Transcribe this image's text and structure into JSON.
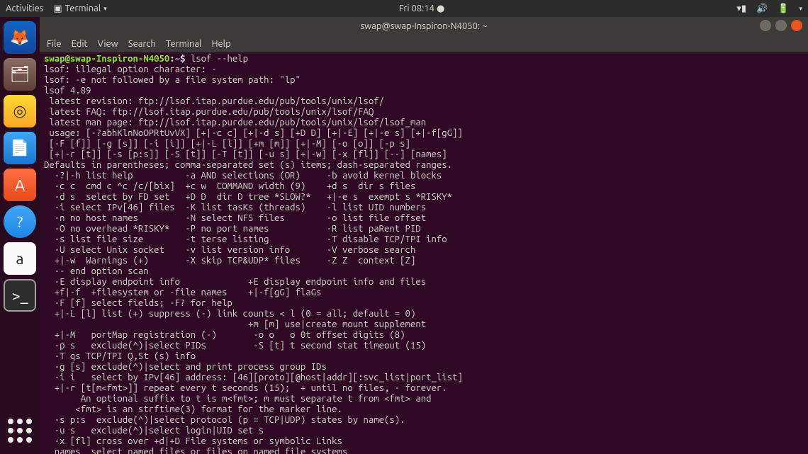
{
  "topbar": {
    "activities": "Activities",
    "app_menu": "Terminal",
    "clock": "Fri 08:14",
    "indicators": {
      "wifi": "wifi-icon",
      "volume": "volume-icon",
      "battery": "battery-icon",
      "power": "power-icon"
    }
  },
  "launcher": [
    {
      "name": "firefox",
      "glyph": "🦊"
    },
    {
      "name": "files",
      "glyph": "🗂"
    },
    {
      "name": "rhythmbox",
      "glyph": "◎"
    },
    {
      "name": "writer",
      "glyph": "📄"
    },
    {
      "name": "software",
      "glyph": "A"
    },
    {
      "name": "help",
      "glyph": "?"
    },
    {
      "name": "amazon",
      "glyph": "a"
    },
    {
      "name": "terminal",
      "glyph": ">_"
    }
  ],
  "window": {
    "title": "swap@swap-Inspiron-N4050: ~",
    "menus": [
      "File",
      "Edit",
      "View",
      "Search",
      "Terminal",
      "Help"
    ]
  },
  "prompt": {
    "user_host": "swap@swap-Inspiron-N4050",
    "sep": ":",
    "path": "~",
    "dollar": "$",
    "command": "lsof --help"
  },
  "terminal_output": [
    "lsof: illegal option character: -",
    "lsof: -e not followed by a file system path: \"lp\"",
    "lsof 4.89",
    " latest revision: ftp://lsof.itap.purdue.edu/pub/tools/unix/lsof/",
    " latest FAQ: ftp://lsof.itap.purdue.edu/pub/tools/unix/lsof/FAQ",
    " latest man page: ftp://lsof.itap.purdue.edu/pub/tools/unix/lsof/lsof_man",
    " usage: [-?abhKlnNoOPRtUvVX] [+|-c c] [+|-d s] [+D D] [+|-E] [+|-e s] [+|-f[gG]]",
    " [-F [f]] [-g [s]] [-i [i]] [+|-L [l]] [+m [m]] [+|-M] [-o [o]] [-p s]",
    " [+|-r [t]] [-s [p:s]] [-S [t]] [-T [t]] [-u s] [+|-w] [-x [fl]] [--] [names]",
    "Defaults in parentheses; comma-separated set (s) items; dash-separated ranges.",
    "  -?|-h list help          -a AND selections (OR)     -b avoid kernel blocks",
    "  -c c  cmd c ^c /c/[bix]  +c w  COMMAND width (9)    +d s  dir s files",
    "  -d s  select by FD set   +D D  dir D tree *SLOW?*   +|-e s  exempt s *RISKY*",
    "  -i select IPv[46] files  -K list tasKs (threads)    -l list UID numbers",
    "  -n no host names         -N select NFS files        -o list file offset",
    "  -O no overhead *RISKY*   -P no port names           -R list paRent PID",
    "  -s list file size        -t terse listing           -T disable TCP/TPI info",
    "  -U select Unix socket    -v list version info       -V verbose search",
    "  +|-w  Warnings (+)       -X skip TCP&UDP* files     -Z Z  context [Z]",
    "  -- end option scan     ",
    "  -E display endpoint info             +E display endpoint info and files",
    "  +f|-f  +filesystem or -file names    +|-f[gG] flaGs ",
    "  -F [f] select fields; -F? for help  ",
    "  +|-L [l] list (+) suppress (-) link counts < l (0 = all; default = 0)",
    "                                       +m [m] use|create mount supplement",
    "  +|-M   portMap registration (-)       -o o   o 0t offset digits (8)",
    "  -p s   exclude(^)|select PIDs         -S [t] t second stat timeout (15)",
    "  -T qs TCP/TPI Q,St (s) info",
    "  -g [s] exclude(^)|select and print process group IDs",
    "  -i i   select by IPv[46] address: [46][proto][@host|addr][:svc_list|port_list]",
    "  +|-r [t[m<fmt>]] repeat every t seconds (15);  + until no files, - forever.",
    "       An optional suffix to t is m<fmt>; m must separate t from <fmt> and",
    "      <fmt> is an strftime(3) format for the marker line.",
    "  -s p:s  exclude(^)|select protocol (p = TCP|UDP) states by name(s).",
    "  -u s   exclude(^)|select login|UID set s",
    "  -x [fl] cross over +d|+D File systems or symbolic Links",
    "  names  select named files or files on named file systems"
  ]
}
